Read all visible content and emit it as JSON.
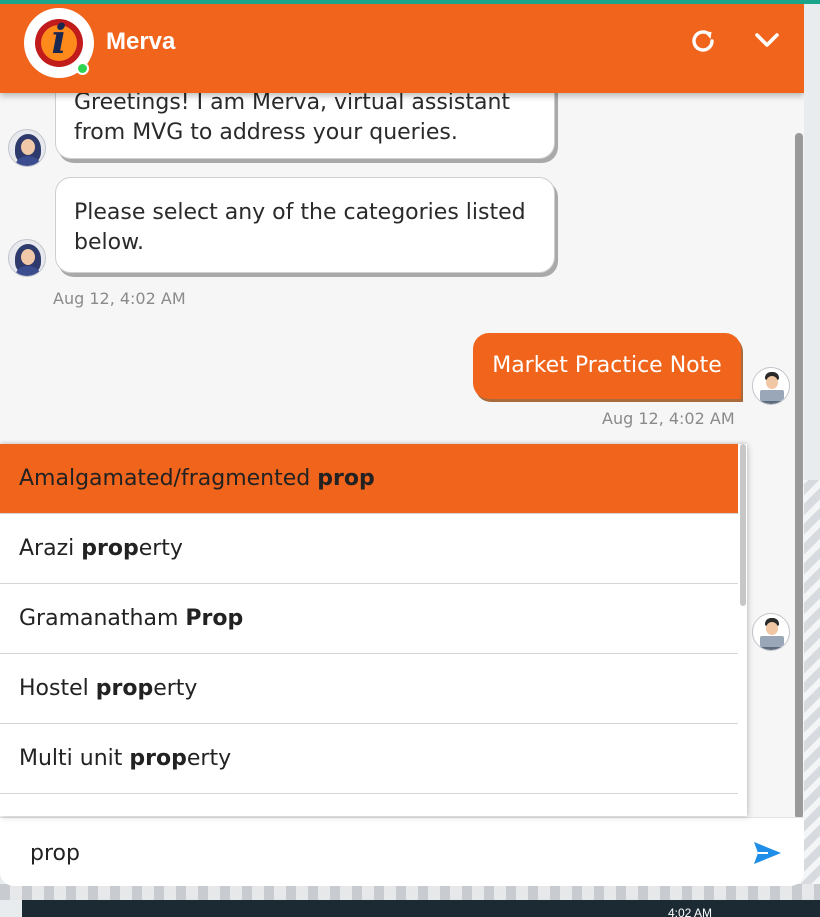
{
  "widget": {
    "title": "Merva",
    "logo_glyph": "i",
    "status": "online",
    "accent_color": "#f0641c"
  },
  "header": {
    "refresh_icon": "refresh-icon",
    "collapse_icon": "chevron-down-icon"
  },
  "messages": [
    {
      "from": "bot",
      "text": "Greetings! I am Merva, virtual assistant from MVG to address your queries."
    },
    {
      "from": "bot",
      "text": "Please select any of the categories listed below."
    },
    {
      "from": "user",
      "text": "Market Practice Note"
    }
  ],
  "timestamps": {
    "bot": "Aug 12, 4:02 AM",
    "user": "Aug 12, 4:02 AM"
  },
  "suggestions": [
    {
      "prefix": "Amalgamated/fragmented ",
      "match": "prop",
      "suffix": "",
      "active": true
    },
    {
      "prefix": "Arazi ",
      "match": "prop",
      "suffix": "erty",
      "active": false
    },
    {
      "prefix": "Gramanatham ",
      "match": "Prop",
      "suffix": "",
      "active": false
    },
    {
      "prefix": "Hostel ",
      "match": "prop",
      "suffix": "erty",
      "active": false
    },
    {
      "prefix": "Multi unit ",
      "match": "prop",
      "suffix": "erty",
      "active": false
    }
  ],
  "input": {
    "value": "prop",
    "send_icon": "send-icon"
  },
  "taskbar": {
    "time": "4:02 AM"
  }
}
